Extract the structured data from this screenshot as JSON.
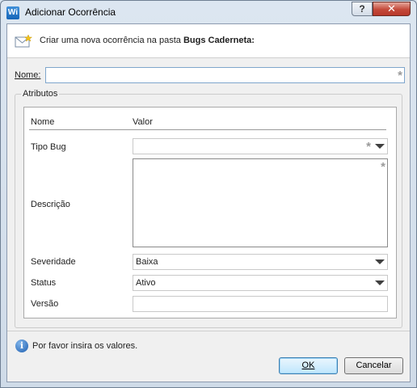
{
  "window": {
    "title": "Adicionar Ocorrência",
    "app_icon_text": "Wi",
    "help_label": "?",
    "close_label": "✕"
  },
  "header": {
    "text_prefix": "Criar uma nova ocorrência na pasta",
    "folder_name": "Bugs Caderneta:"
  },
  "nome": {
    "label": "Nome:",
    "value": ""
  },
  "attributes": {
    "group_title": "Atributos",
    "columns": {
      "name": "Nome",
      "value": "Valor"
    },
    "rows": [
      {
        "name": "Tipo Bug",
        "value": "",
        "type": "dropdown",
        "required": true
      },
      {
        "name": "Descrição",
        "value": "",
        "type": "textarea",
        "required": true
      },
      {
        "name": "Severidade",
        "value": "Baixa",
        "type": "dropdown",
        "required": false
      },
      {
        "name": "Status",
        "value": "Ativo",
        "type": "dropdown",
        "required": false
      },
      {
        "name": "Versão",
        "value": "",
        "type": "text",
        "required": false
      }
    ]
  },
  "required_marker": "*",
  "footer": {
    "info_icon": "i",
    "info_text": "Por favor insira os valores.",
    "ok_label": "OK",
    "cancel_label": "Cancelar"
  },
  "colors": {
    "title_bar": "#dce6f1",
    "close_button": "#c4493a",
    "ok_button": "#bee6fd"
  }
}
